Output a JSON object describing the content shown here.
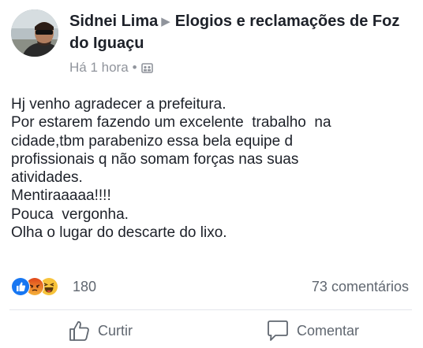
{
  "post": {
    "author": "Sidnei Lima",
    "group": "Elogios e reclamações de Foz do Iguaçu",
    "timestamp": "Há 1 hora",
    "audience_icon": "group-icon",
    "body_lines": [
      "Hj venho agradecer a prefeitura.",
      "Por estarem fazendo um excelente  trabalho  na",
      "cidade,tbm parabenizo essa bela equipe d",
      "profissionais q não somam forças nas suas",
      "atividades.",
      "Mentiraaaaa!!!!",
      "Pouca  vergonha.",
      "Olha o lugar do descarte do lixo."
    ]
  },
  "reactions": {
    "icons": [
      "like-reaction-icon",
      "angry-reaction-icon",
      "haha-reaction-icon"
    ],
    "count": "180",
    "comments": "73 comentários"
  },
  "actions": {
    "like_label": "Curtir",
    "comment_label": "Comentar"
  },
  "colors": {
    "like_blue": "#1877f2",
    "angry_orange": "#e9710f",
    "haha_yellow": "#f7c33b",
    "muted_text": "#606770"
  }
}
